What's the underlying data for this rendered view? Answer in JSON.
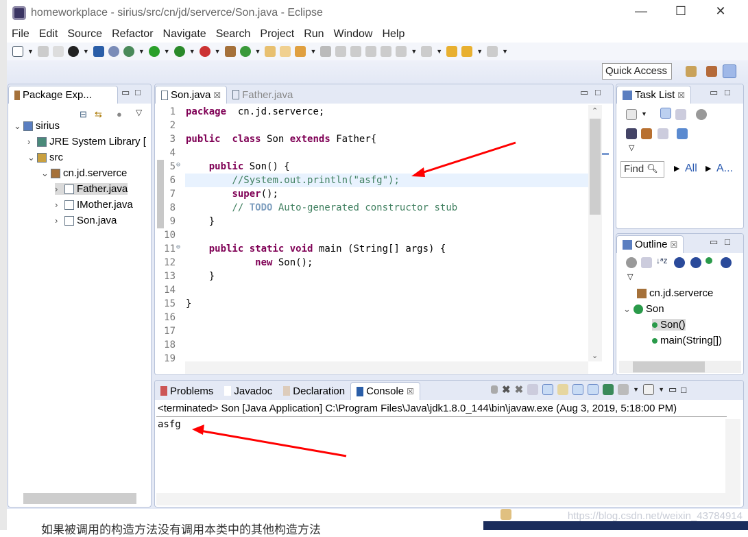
{
  "window": {
    "title": "homeworkplace - sirius/src/cn/jd/serverce/Son.java - Eclipse",
    "minimize": "—",
    "maximize": "☐",
    "close": "✕"
  },
  "menu": [
    "File",
    "Edit",
    "Source",
    "Refactor",
    "Navigate",
    "Search",
    "Project",
    "Run",
    "Window",
    "Help"
  ],
  "quick_access": "Quick Access",
  "package_explorer": {
    "tab": "Package Exp...",
    "tree": [
      {
        "label": "sirius",
        "level": 0,
        "arrow": "⌄"
      },
      {
        "label": "JRE System Library [",
        "level": 1,
        "arrow": "›"
      },
      {
        "label": "src",
        "level": 1,
        "arrow": "⌄"
      },
      {
        "label": "cn.jd.serverce",
        "level": 2,
        "arrow": "⌄"
      },
      {
        "label": "Father.java",
        "level": 3,
        "arrow": "›"
      },
      {
        "label": "IMother.java",
        "level": 3,
        "arrow": "›"
      },
      {
        "label": "Son.java",
        "level": 3,
        "arrow": "›"
      }
    ]
  },
  "editor": {
    "tabs": [
      {
        "label": "Son.java",
        "active": true
      },
      {
        "label": "Father.java",
        "active": false
      }
    ],
    "line_numbers": [
      "1",
      "2",
      "3",
      "4",
      "5",
      "6",
      "7",
      "8",
      "9",
      "10",
      "11",
      "12",
      "13",
      "14",
      "15",
      "16",
      "17",
      "18",
      "19"
    ],
    "lines": [
      [
        [
          "kw",
          "package"
        ],
        [
          "",
          "  cn.jd.serverce;"
        ]
      ],
      [],
      [
        [
          "kw",
          "public"
        ],
        [
          "",
          "  "
        ],
        [
          "kw",
          "class"
        ],
        [
          "",
          " Son "
        ],
        [
          "kw",
          "extends"
        ],
        [
          "",
          " Father{"
        ]
      ],
      [],
      [
        [
          "",
          "    "
        ],
        [
          "kw",
          "public"
        ],
        [
          "",
          " Son() {"
        ]
      ],
      [
        [
          "",
          "        "
        ],
        [
          "cm",
          "//System.out.println(\"asfg\");"
        ]
      ],
      [
        [
          "",
          "        "
        ],
        [
          "kw",
          "super"
        ],
        [
          "",
          "();"
        ]
      ],
      [
        [
          "",
          "        "
        ],
        [
          "cm",
          "// "
        ],
        [
          "todo",
          "TODO"
        ],
        [
          "cm",
          " Auto-generated constructor stub"
        ]
      ],
      [
        [
          "",
          "    }"
        ]
      ],
      [],
      [
        [
          "",
          "    "
        ],
        [
          "kw",
          "public"
        ],
        [
          "",
          " "
        ],
        [
          "kw",
          "static"
        ],
        [
          "",
          " "
        ],
        [
          "kw",
          "void"
        ],
        [
          "",
          " main (String[] args) {"
        ]
      ],
      [
        [
          "",
          "            "
        ],
        [
          "kw",
          "new"
        ],
        [
          "",
          " Son();"
        ]
      ],
      [
        [
          "",
          "    }"
        ]
      ],
      [],
      [
        [
          "",
          "}"
        ]
      ],
      [],
      [],
      [],
      []
    ]
  },
  "task_list": {
    "tab": "Task List",
    "find": "Find",
    "all": "All",
    "activate": "A..."
  },
  "outline": {
    "tab": "Outline",
    "items": [
      {
        "label": "cn.jd.serverce"
      },
      {
        "label": "Son"
      },
      {
        "label": "Son()"
      },
      {
        "label": "main(String[])"
      }
    ]
  },
  "console": {
    "tabs": [
      "Problems",
      "Javadoc",
      "Declaration",
      "Console"
    ],
    "status": "<terminated> Son [Java Application] C:\\Program Files\\Java\\jdk1.8.0_144\\bin\\javaw.exe (Aug 3, 2019, 5:18:00 PM)",
    "output": "asfg"
  },
  "watermark": "https://blog.csdn.net/weixin_43784914",
  "background_text": "如果被调用的构造方法没有调用本类中的其他构造方法",
  "colors": {
    "keyword": "#7f0055",
    "comment": "#3f7f5f",
    "string": "#2a00ff",
    "annotation_arrow": "#ff0000"
  }
}
